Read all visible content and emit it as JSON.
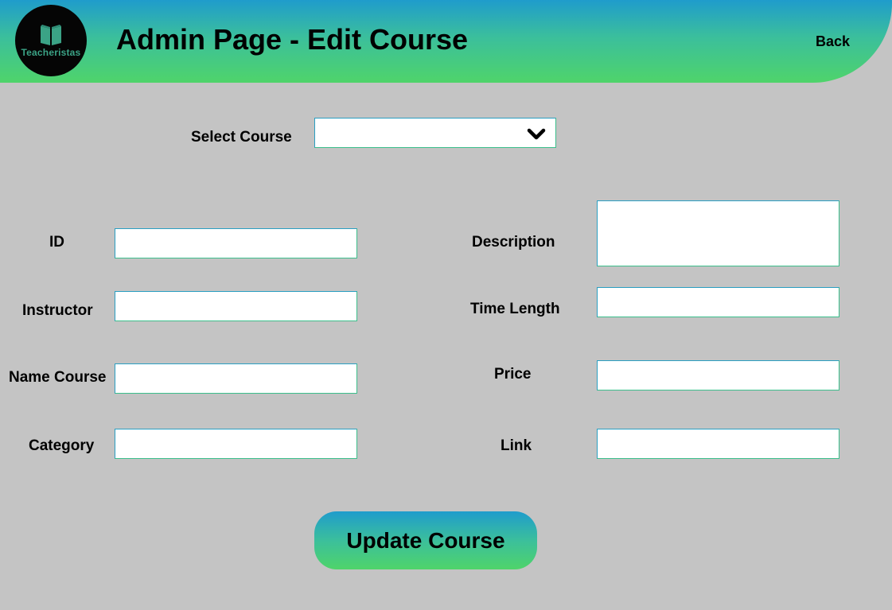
{
  "header": {
    "logo_text": "Teacheristas",
    "title": "Admin Page - Edit Course",
    "back_label": "Back"
  },
  "select_course": {
    "label": "Select Course",
    "value": ""
  },
  "form": {
    "id": {
      "label": "ID",
      "value": ""
    },
    "instructor": {
      "label": "Instructor",
      "value": ""
    },
    "name_course": {
      "label": "Name Course",
      "value": ""
    },
    "category": {
      "label": "Category",
      "value": ""
    },
    "description": {
      "label": "Description",
      "value": ""
    },
    "time_length": {
      "label": "Time Length",
      "value": ""
    },
    "price": {
      "label": "Price",
      "value": ""
    },
    "link": {
      "label": "Link",
      "value": ""
    }
  },
  "update_button_label": "Update Course",
  "colors": {
    "background": "#c4c4c4",
    "gradient_top": "#1f9ccc",
    "gradient_bottom": "#4fd46a",
    "logo_bg": "#050505",
    "logo_book": "#3ba386"
  }
}
